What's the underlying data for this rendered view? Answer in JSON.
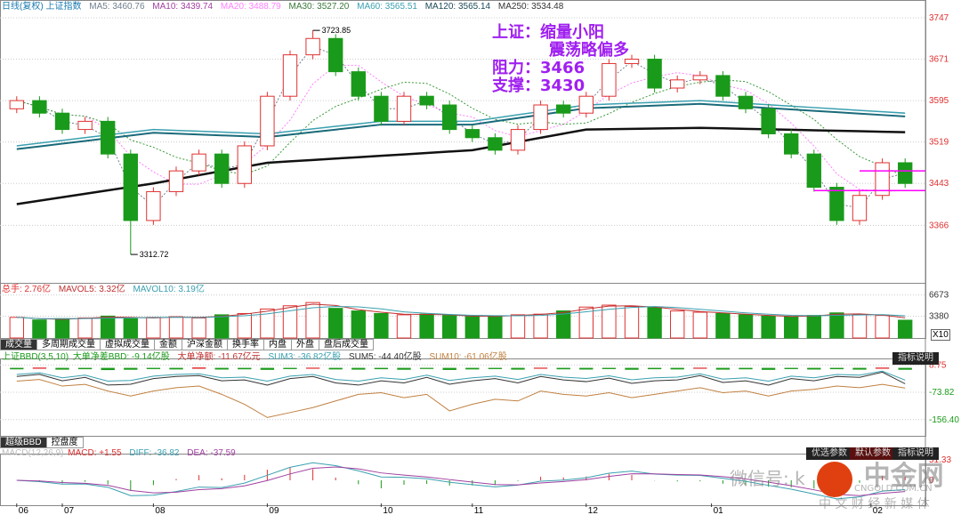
{
  "header": {
    "title": "日线(复权) 上证指数",
    "ma5": "MA5: 3460.76",
    "ma10": "MA10: 3439.74",
    "ma20": "MA20: 3488.79",
    "ma30": "MA30: 3527.20",
    "ma60": "MA60: 3565.51",
    "ma120": "MA120: 3565.14",
    "ma250": "MA250: 3534.48"
  },
  "annotation": {
    "line1": "上证：缩量小阳",
    "line2": "震荡略偏多",
    "line3": "阻力：3466",
    "line4": "支撑：3430"
  },
  "volume_header": {
    "total": "总手: 2.76亿",
    "mavol5": "MAVOL5: 3.32亿",
    "mavol10": "MAVOL10: 3.19亿"
  },
  "volume_tabs": [
    "成交量",
    "多周期成交量",
    "虚拟成交量",
    "金额",
    "沪深金额",
    "换手率",
    "内盘",
    "外盘",
    "盘后成交量"
  ],
  "bbd_header": {
    "name": "上证BBD(3,5,10)",
    "bbd": "大单净差BBD: -9.14亿股",
    "net": "大单净额: -11.67亿元",
    "sum3": "SUM3: -36.82亿股",
    "sum5": "SUM5: -44.40亿股",
    "sum10": "SUM10: -61.06亿股"
  },
  "bbd_tabs": [
    "超级BBD",
    "控盘度"
  ],
  "macd_header": {
    "name": "MACD(12,26,9)",
    "macd": "MACD: +1.55",
    "diff": "DIFF: -36.82",
    "dea": "DEA: -37.59"
  },
  "panel_buttons": {
    "explain": "指标说明",
    "optimal": "优选参数",
    "default": "默认参数"
  },
  "volume_scale_label": "X10",
  "watermark": {
    "wechat": "微信号: k...",
    "logo": "中金网",
    "domain": "CNGOLD.COM.CN",
    "tagline": "中 文 财 经 新 媒 体"
  },
  "colors": {
    "up": "#e03030",
    "down": "#1a9a1a",
    "ma5": "#708090",
    "ma10": "#a040a0",
    "ma20": "#ff80ff",
    "ma30": "#3a9a3a",
    "ma60": "#3aa0b0",
    "ma120": "#1a6a7a",
    "ma250": "#111111",
    "annotation": "#a020f0",
    "support_line": "#ff00ff"
  },
  "chart_data": {
    "type": "candlestick",
    "x_ticks": [
      {
        "label": "06",
        "index": 0
      },
      {
        "label": "07",
        "index": 2
      },
      {
        "label": "08",
        "index": 6
      },
      {
        "label": "09",
        "index": 11
      },
      {
        "label": "10",
        "index": 16
      },
      {
        "label": "11",
        "index": 20
      },
      {
        "label": "12",
        "index": 25
      },
      {
        "label": "01",
        "index": 30.5
      },
      {
        "label": "02",
        "index": 37.5
      }
    ],
    "y_ticks": [
      3747,
      3671,
      3595,
      3519,
      3443,
      3366
    ],
    "ylim": [
      3290,
      3760
    ],
    "annotations": [
      {
        "label": "3723.85",
        "index": 13,
        "value": 3723.85
      },
      {
        "label": "3312.72",
        "index": 5,
        "value": 3312.72
      }
    ],
    "horizontal_lines": [
      3466,
      3430
    ],
    "open": [
      3580,
      3595,
      3572,
      3542,
      3557,
      3497,
      3375,
      3428,
      3466,
      3497,
      3443,
      3512,
      3603,
      3679,
      3709,
      3648,
      3603,
      3557,
      3603,
      3587,
      3542,
      3527,
      3504,
      3542,
      3587,
      3572,
      3603,
      3663,
      3671,
      3618,
      3633,
      3641,
      3603,
      3580,
      3534,
      3497,
      3436,
      3375,
      3421,
      3481
    ],
    "high": [
      3603,
      3603,
      3580,
      3565,
      3565,
      3505,
      3436,
      3474,
      3505,
      3505,
      3520,
      3611,
      3687,
      3723.85,
      3717,
      3656,
      3611,
      3611,
      3611,
      3595,
      3550,
      3535,
      3550,
      3595,
      3595,
      3611,
      3671,
      3679,
      3679,
      3641,
      3649,
      3649,
      3611,
      3588,
      3542,
      3505,
      3444,
      3429,
      3489,
      3489
    ],
    "low": [
      3572,
      3564,
      3534,
      3534,
      3489,
      3312.72,
      3367,
      3420,
      3458,
      3435,
      3435,
      3504,
      3595,
      3671,
      3640,
      3595,
      3549,
      3549,
      3579,
      3534,
      3519,
      3496,
      3496,
      3534,
      3564,
      3564,
      3595,
      3655,
      3610,
      3610,
      3625,
      3595,
      3572,
      3526,
      3489,
      3428,
      3367,
      3367,
      3413,
      3435
    ],
    "close": [
      3595,
      3572,
      3542,
      3557,
      3497,
      3375,
      3428,
      3466,
      3497,
      3443,
      3512,
      3603,
      3679,
      3709,
      3648,
      3603,
      3557,
      3603,
      3587,
      3542,
      3527,
      3504,
      3542,
      3587,
      3572,
      3603,
      3663,
      3671,
      3618,
      3633,
      3641,
      3603,
      3580,
      3534,
      3497,
      3436,
      3375,
      3421,
      3481,
      3443
    ],
    "ma120": [
      [
        0,
        3512
      ],
      [
        6,
        3542
      ],
      [
        11,
        3534
      ],
      [
        16,
        3557
      ],
      [
        20,
        3557
      ],
      [
        25,
        3587
      ],
      [
        30,
        3595
      ],
      [
        39,
        3572
      ]
    ],
    "ma250": [
      [
        0,
        3405
      ],
      [
        6,
        3443
      ],
      [
        11,
        3481
      ],
      [
        20,
        3504
      ],
      [
        25,
        3542
      ],
      [
        30,
        3545
      ],
      [
        39,
        3537
      ]
    ],
    "volume": {
      "unit": "亿",
      "y_ticks": [
        6673,
        3380
      ],
      "values": [
        3.2,
        2.8,
        3.0,
        3.1,
        3.4,
        3.0,
        3.2,
        3.3,
        3.1,
        3.6,
        3.8,
        4.5,
        5.0,
        5.5,
        4.6,
        4.2,
        3.8,
        3.6,
        3.7,
        3.5,
        3.3,
        3.4,
        3.6,
        3.7,
        4.2,
        4.8,
        5.1,
        4.9,
        4.7,
        4.2,
        4.0,
        3.8,
        3.6,
        3.4,
        3.3,
        3.5,
        3.9,
        3.6,
        3.5,
        2.76
      ]
    },
    "bbd": {
      "y_ticks": [
        8.75,
        -73.82,
        -156.4
      ],
      "bbd": [
        -5,
        3,
        -8,
        -4,
        -12,
        -9,
        -3,
        -6,
        4,
        -7,
        -5,
        -10,
        -3,
        2,
        -6,
        -8,
        -4,
        -9,
        -2,
        -11,
        -6,
        -3,
        -8,
        2,
        -5,
        -7,
        -3,
        -9,
        -4,
        -6,
        2,
        -8,
        -5,
        -10,
        -3,
        -7,
        -4,
        -8,
        3,
        -9
      ],
      "sum3": [
        -20,
        -15,
        -30,
        -22,
        -40,
        -38,
        -25,
        -20,
        -18,
        -30,
        -28,
        -40,
        -25,
        -20,
        -35,
        -40,
        -30,
        -35,
        -22,
        -38,
        -30,
        -25,
        -35,
        -20,
        -28,
        -32,
        -24,
        -36,
        -30,
        -28,
        -18,
        -34,
        -30,
        -40,
        -25,
        -30,
        -20,
        -22,
        -10,
        -37
      ],
      "sum10": [
        -40,
        -35,
        -55,
        -50,
        -70,
        -85,
        -70,
        -60,
        -55,
        -80,
        -110,
        -150,
        -135,
        -120,
        -100,
        -80,
        -75,
        -90,
        -80,
        -130,
        -110,
        -95,
        -100,
        -70,
        -80,
        -85,
        -75,
        -90,
        -80,
        -70,
        -60,
        -75,
        -70,
        -85,
        -70,
        -65,
        -55,
        -60,
        -50,
        -61
      ]
    },
    "macd": {
      "y_ticks": [
        51.33,
        0
      ]
    }
  }
}
